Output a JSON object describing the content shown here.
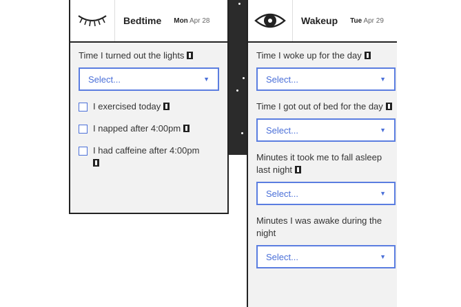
{
  "bedtime": {
    "title": "Bedtime",
    "day": "Mon",
    "date": "Apr 28",
    "fields": [
      {
        "label": "Time I turned out the lights",
        "select": "Select..."
      }
    ],
    "checks": [
      {
        "label": "I exercised today"
      },
      {
        "label": "I napped after 4:00pm"
      },
      {
        "label": "I had caffeine after 4:00pm"
      }
    ]
  },
  "wakeup": {
    "title": "Wakeup",
    "day": "Tue",
    "date": "Apr 29",
    "fields": [
      {
        "label": "Time I woke up for the day",
        "select": "Select..."
      },
      {
        "label": "Time I got out of bed for the day",
        "select": "Select..."
      },
      {
        "label": "Minutes it took me to fall asleep last night",
        "select": "Select..."
      },
      {
        "label": "Minutes I was awake during the night",
        "select": "Select..."
      }
    ]
  },
  "icons": {
    "bedtime": "closed-eye-icon",
    "wakeup": "open-eye-icon",
    "night": "crescent-moon-icon",
    "info": "info-icon",
    "dropdown": "caret-down-icon"
  },
  "colors": {
    "accent": "#5a7de0",
    "night_bg": "#2b2b2b",
    "card_bg": "#f2f2f2"
  }
}
